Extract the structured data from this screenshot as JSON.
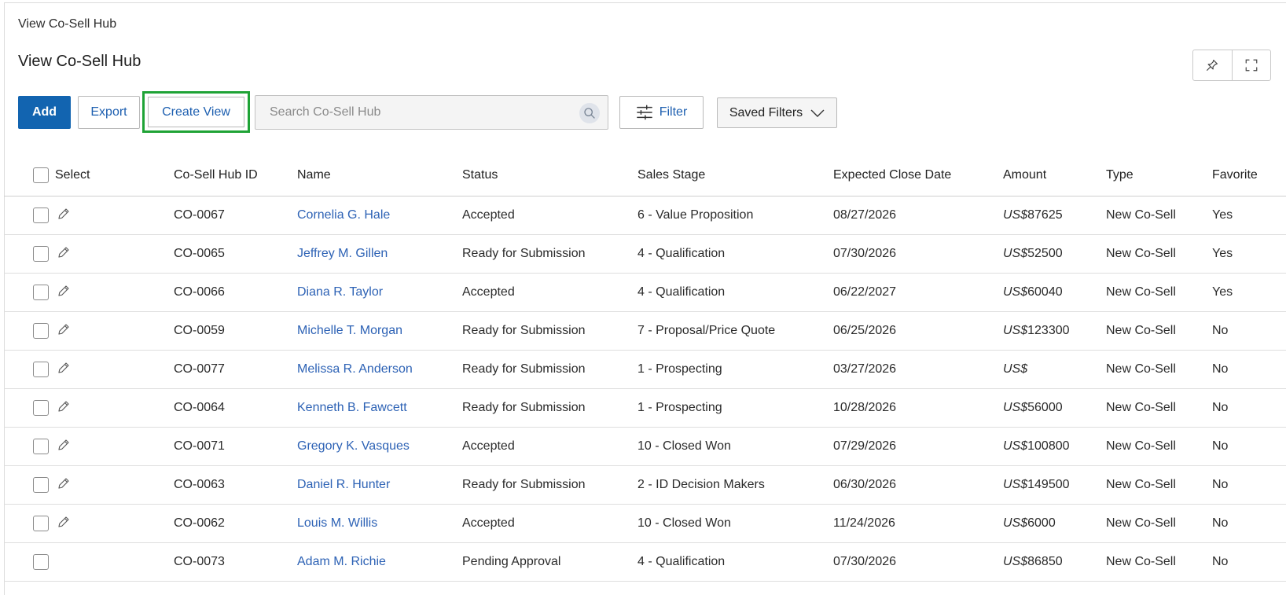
{
  "breadcrumb": "View Co-Sell Hub",
  "page_title": "View Co-Sell Hub",
  "toolbar": {
    "add_label": "Add",
    "export_label": "Export",
    "create_view_label": "Create View",
    "search_placeholder": "Search Co-Sell Hub",
    "filter_label": "Filter",
    "saved_filters_label": "Saved Filters"
  },
  "colors": {
    "primary": "#1264b0",
    "link": "#2d62b5",
    "highlight": "#1fa336"
  },
  "icons": {
    "pin": "pin-icon",
    "expand": "expand-icon",
    "search": "search-icon",
    "filter": "sliders-icon",
    "chevron": "chevron-down-icon",
    "edit": "pencil-icon"
  },
  "table": {
    "columns": {
      "select": "Select",
      "id": "Co-Sell Hub ID",
      "name": "Name",
      "status": "Status",
      "stage": "Sales Stage",
      "close_date": "Expected Close Date",
      "amount": "Amount",
      "type": "Type",
      "favorite": "Favorite"
    },
    "rows": [
      {
        "id": "CO-0067",
        "name": "Cornelia G. Hale",
        "status": "Accepted",
        "stage": "6 - Value Proposition",
        "close_date": "08/27/2026",
        "currency": "US$",
        "amount": "87625",
        "type": "New Co-Sell",
        "favorite": "Yes",
        "editable": true
      },
      {
        "id": "CO-0065",
        "name": "Jeffrey M. Gillen",
        "status": "Ready for Submission",
        "stage": "4 - Qualification",
        "close_date": "07/30/2026",
        "currency": "US$",
        "amount": "52500",
        "type": "New Co-Sell",
        "favorite": "Yes",
        "editable": true
      },
      {
        "id": "CO-0066",
        "name": "Diana R. Taylor",
        "status": "Accepted",
        "stage": "4 - Qualification",
        "close_date": "06/22/2027",
        "currency": "US$",
        "amount": "60040",
        "type": "New Co-Sell",
        "favorite": "Yes",
        "editable": true
      },
      {
        "id": "CO-0059",
        "name": "Michelle T. Morgan",
        "status": "Ready for Submission",
        "stage": "7 - Proposal/Price Quote",
        "close_date": "06/25/2026",
        "currency": "US$",
        "amount": "123300",
        "type": "New Co-Sell",
        "favorite": "No",
        "editable": true
      },
      {
        "id": "CO-0077",
        "name": "Melissa R. Anderson",
        "status": "Ready for Submission",
        "stage": "1 - Prospecting",
        "close_date": "03/27/2026",
        "currency": "US$",
        "amount": "",
        "type": "New Co-Sell",
        "favorite": "No",
        "editable": true
      },
      {
        "id": "CO-0064",
        "name": "Kenneth B. Fawcett",
        "status": "Ready for Submission",
        "stage": "1 - Prospecting",
        "close_date": "10/28/2026",
        "currency": "US$",
        "amount": "56000",
        "type": "New Co-Sell",
        "favorite": "No",
        "editable": true
      },
      {
        "id": "CO-0071",
        "name": "Gregory K. Vasques",
        "status": "Accepted",
        "stage": "10 - Closed Won",
        "close_date": "07/29/2026",
        "currency": "US$",
        "amount": "100800",
        "type": "New Co-Sell",
        "favorite": "No",
        "editable": true
      },
      {
        "id": "CO-0063",
        "name": "Daniel R. Hunter",
        "status": "Ready for Submission",
        "stage": "2 - ID Decision Makers",
        "close_date": "06/30/2026",
        "currency": "US$",
        "amount": "149500",
        "type": "New Co-Sell",
        "favorite": "No",
        "editable": true
      },
      {
        "id": "CO-0062",
        "name": "Louis M. Willis",
        "status": "Accepted",
        "stage": "10 - Closed Won",
        "close_date": "11/24/2026",
        "currency": "US$",
        "amount": "6000",
        "type": "New Co-Sell",
        "favorite": "No",
        "editable": true
      },
      {
        "id": "CO-0073",
        "name": "Adam M. Richie",
        "status": "Pending Approval",
        "stage": "4 - Qualification",
        "close_date": "07/30/2026",
        "currency": "US$",
        "amount": "86850",
        "type": "New Co-Sell",
        "favorite": "No",
        "editable": false
      }
    ]
  }
}
